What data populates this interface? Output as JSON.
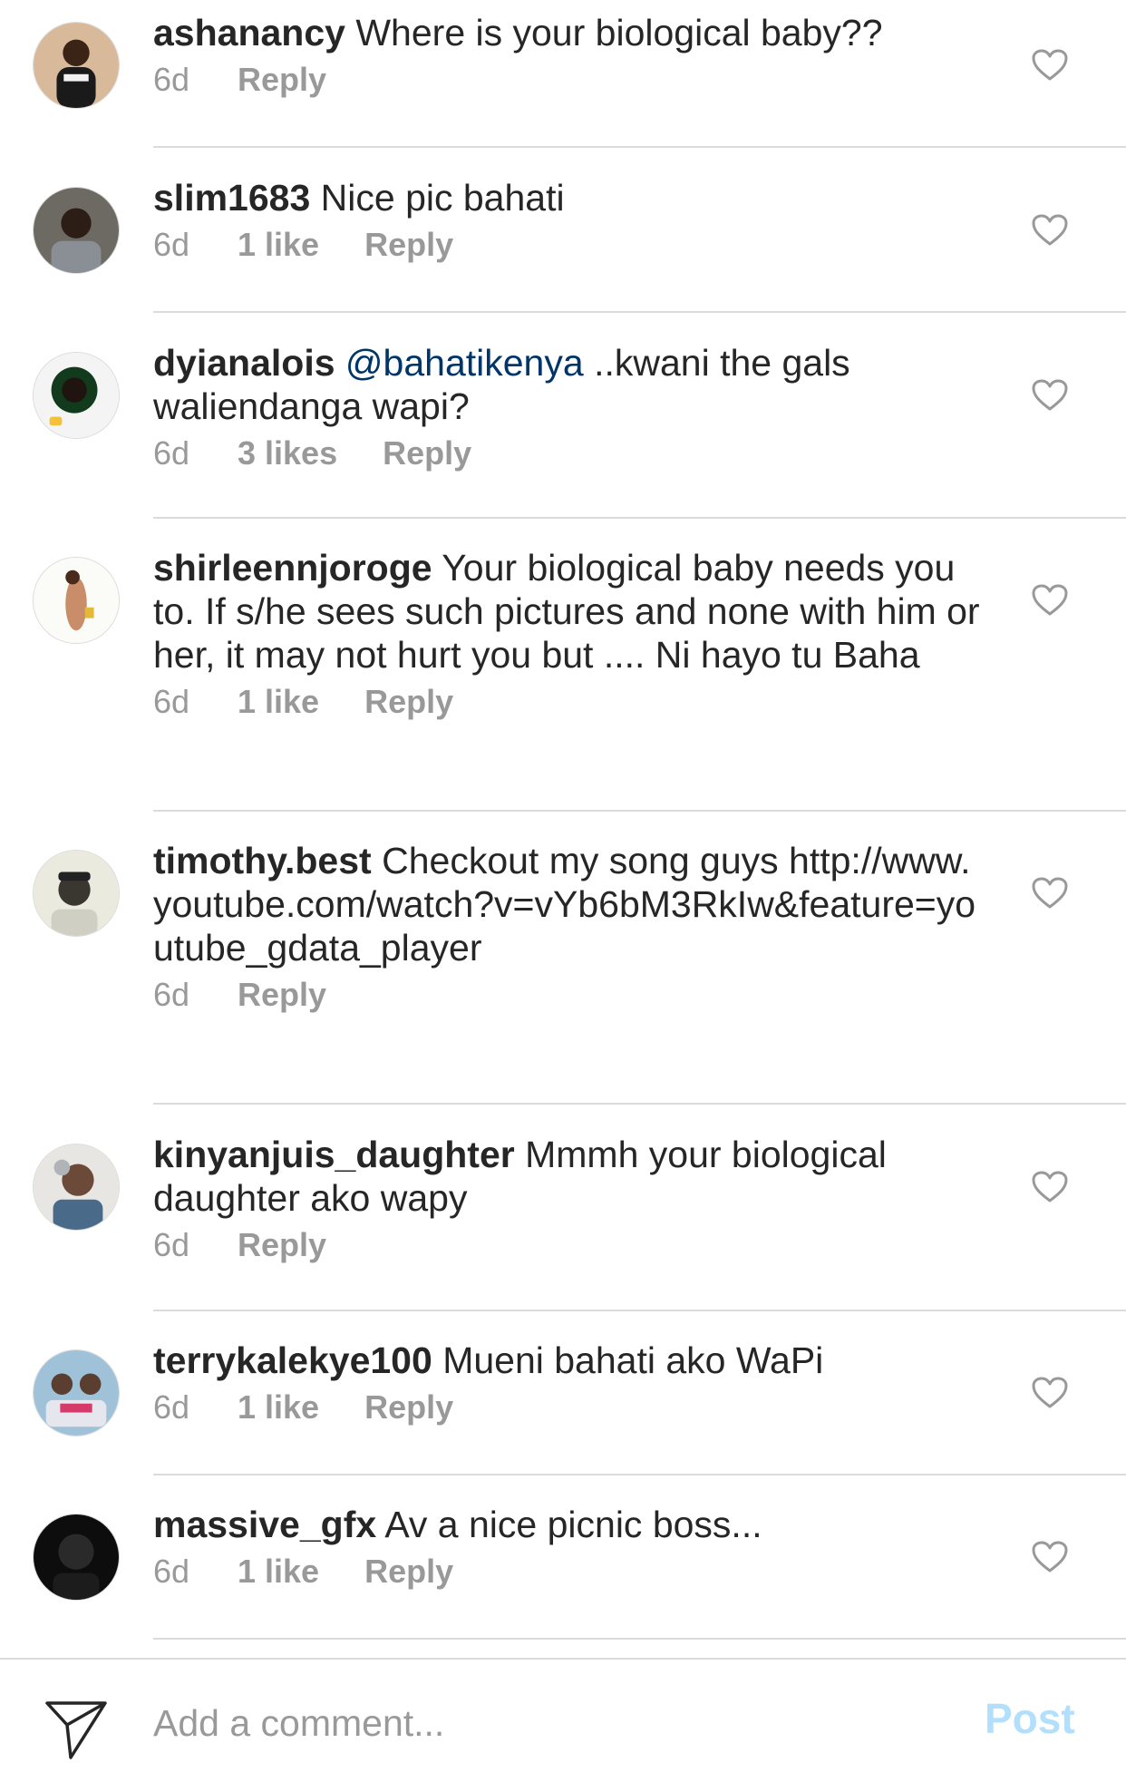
{
  "comments": [
    {
      "username": "ashanancy",
      "mention": "",
      "text": "Where is your biological baby??",
      "age": "6d",
      "likes": "",
      "reply_label": "Reply"
    },
    {
      "username": "slim1683",
      "mention": "",
      "text": "Nice pic bahati",
      "age": "6d",
      "likes": "1 like",
      "reply_label": "Reply"
    },
    {
      "username": "dyianalois",
      "mention": "@bahatikenya",
      "text": "..kwani the gals waliendanga wapi?",
      "age": "6d",
      "likes": "3 likes",
      "reply_label": "Reply"
    },
    {
      "username": "shirleennjoroge",
      "mention": "",
      "text": "Your biological baby needs you to.  If s/he sees such pictures and none with him or her, it may not hurt you but .... Ni hayo tu Baha",
      "age": "6d",
      "likes": "1 like",
      "reply_label": "Reply"
    },
    {
      "username": "timothy.best",
      "mention": "",
      "text": "Checkout my song guys http://www.youtube.com/watch?v=vYb6bM3RkIw&feature=youtube_gdata_player",
      "age": "6d",
      "likes": "",
      "reply_label": "Reply"
    },
    {
      "username": "kinyanjuis_daughter",
      "mention": "",
      "text": "Mmmh your biological daughter  ako wapy",
      "age": "6d",
      "likes": "",
      "reply_label": "Reply"
    },
    {
      "username": "terrykalekye100",
      "mention": "",
      "text": "Mueni bahati ako WaPi",
      "age": "6d",
      "likes": "1 like",
      "reply_label": "Reply"
    },
    {
      "username": "massive_gfx",
      "mention": "",
      "text": "Av a nice picnic boss...",
      "age": "6d",
      "likes": "1 like",
      "reply_label": "Reply"
    }
  ],
  "composer": {
    "placeholder": "Add a comment...",
    "post_label": "Post"
  },
  "colors": {
    "text": "#262626",
    "meta": "#999999",
    "mention": "#003569",
    "post_disabled": "#b2dffc",
    "divider": "#dbdbdb"
  },
  "icons": {
    "like": "heart-outline-icon",
    "send": "paper-plane-icon"
  }
}
